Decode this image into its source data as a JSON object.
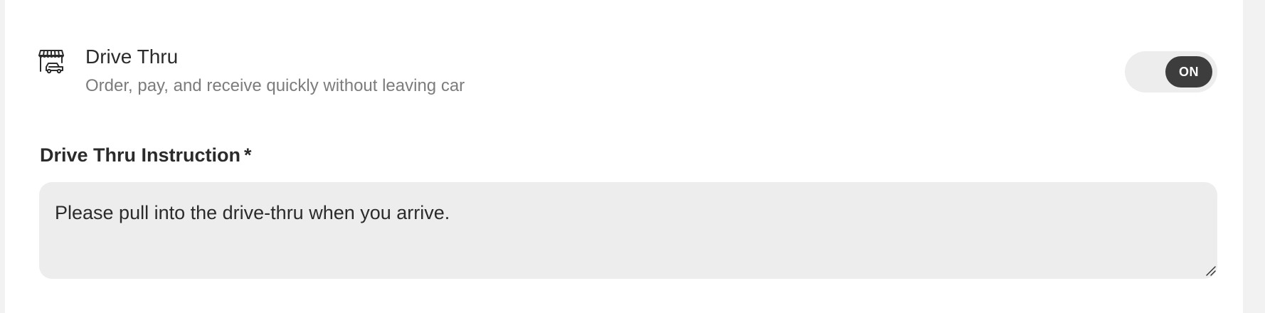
{
  "drive_thru": {
    "icon": "drive-thru-icon",
    "title": "Drive Thru",
    "description": "Order, pay, and receive quickly without leaving car",
    "toggle_label": "ON",
    "enabled": true
  },
  "instruction_field": {
    "label": "Drive Thru Instruction",
    "required_marker": "*",
    "value": "Please pull into the drive-thru when you arrive."
  },
  "colors": {
    "text_primary": "#2b2b2b",
    "text_secondary": "#7c7c7c",
    "toggle_track": "#ededed",
    "toggle_knob": "#3d3d3d",
    "field_background": "#ededed"
  }
}
